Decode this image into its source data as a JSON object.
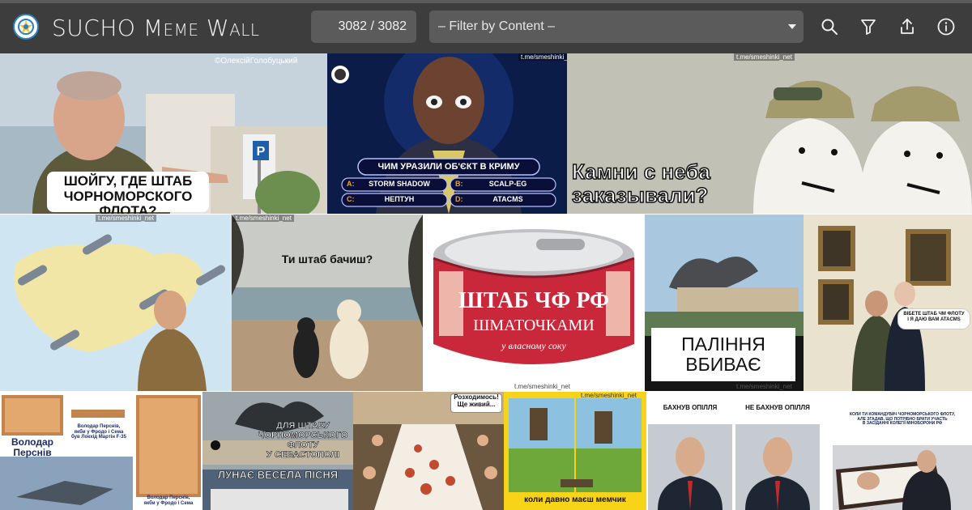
{
  "app": {
    "title": "SUCHO Meme Wall",
    "counter": "3082 / 3082",
    "filter_placeholder": "– Filter by Content –"
  },
  "toolbar": {
    "icons": [
      "search-icon",
      "filter-icon",
      "share-icon",
      "info-icon"
    ]
  },
  "memes": {
    "m1": {
      "caption": "ШОЙГУ, ГДЕ ШТАБ\nЧОРНОМОРСКОГО ФЛОТА?",
      "credit": "©ОлексійГолобуцький"
    },
    "m2": {
      "watermark": "t.me/smeshinki_net",
      "question": "ЧИМ УРАЗИЛИ ОБ'ЄКТ В КРИМУ",
      "answers": [
        "STORM SHADOW",
        "SCALP-EG",
        "НЕПТУН",
        "ATACMS"
      ],
      "letters": [
        "A:",
        "B:",
        "C:",
        "D:"
      ]
    },
    "m3": {
      "caption": "Камни с неба\nзаказывали?",
      "watermark": "t.me/smeshinki_net"
    },
    "m4": {
      "watermark": "t.me/smeshinki_net"
    },
    "m5": {
      "caption": "Ти штаб бачиш?",
      "watermark": "t.me/smeshinki_net"
    },
    "m6": {
      "line1": "ШТАБ ЧФ РФ",
      "line2": "ШМАТОЧКАМИ",
      "line3": "у власному соку",
      "watermark": "t.me/smeshinki_net"
    },
    "m7": {
      "caption": "ПАЛІННЯ\nВБИВАЄ",
      "watermark": "t.me/smeshinki_net"
    },
    "m8": {
      "bubble": "ВІБЕТЕ ШТАБ ЧМ ФЛОТУ\nІ Я ДАЮ ВАМ ATACMS"
    },
    "m9": {
      "label_left": "Володар\nПерснів",
      "label_right": "Володар Перснів,\nякби у Фродо і Сема\nбув Локхід Мартін F-35",
      "label_bottom": "Володар Перснів,\nякби у Фродо і Сема"
    },
    "m10": {
      "caption_top": "ДЛЯ ШТАБУ\nЧОРНОМОРСЬКОГО\nФЛОТУ\nУ СЕВАСТОПОЛІ",
      "caption_bottom": "ЛУНАЄ ВЕСЕЛА ПІСНЯ"
    },
    "m11": {
      "caption": "Розходимось!\nЩе живий..."
    },
    "m12": {
      "caption": "коли давно маєш мемчик",
      "watermark": "t.me/smeshinki_net"
    },
    "m13": {
      "label_left": "БАХНУВ ОПІЛЛЯ",
      "label_right": "НЕ БАХНУВ ОПІЛЛЯ"
    },
    "m14": {
      "caption": "КОЛИ ТИ КОМАНДУВАЧ ЧОРНОМОРСЬКОГО ФЛОТУ,\nАЛЕ ЗГАДАВ, ЩО ПОТРІБНО БРАТИ УЧАСТЬ\nВ ЗАСІДАННІ КОЛЕГІЇ МІНОБОРОНИ РФ"
    }
  },
  "colors": {
    "header_bg": "#3d3d3d",
    "control_bg": "#5b5b5b",
    "header_text": "#f2f2f2",
    "meme_yellow": "#f7d417",
    "can_red": "#c8283a"
  }
}
